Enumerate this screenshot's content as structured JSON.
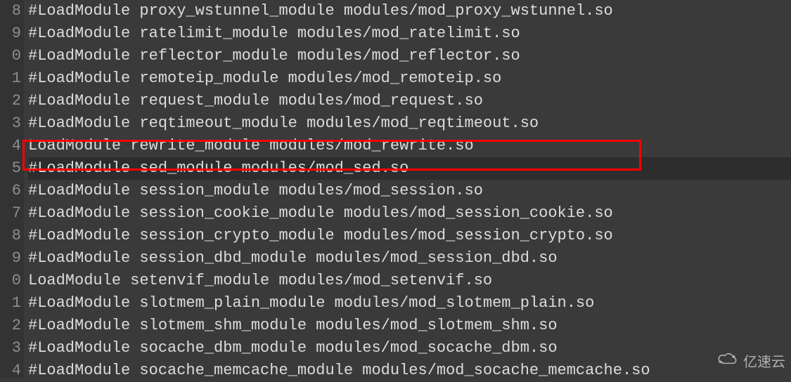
{
  "gutter": {
    "numbers": [
      "8",
      "9",
      "0",
      "1",
      "2",
      "3",
      "4",
      "5",
      "6",
      "7",
      "8",
      "9",
      "0",
      "1",
      "2",
      "3",
      "4"
    ]
  },
  "lines": [
    {
      "text": "#LoadModule proxy_wstunnel_module modules/mod_proxy_wstunnel.so",
      "current": false
    },
    {
      "text": "#LoadModule ratelimit_module modules/mod_ratelimit.so",
      "current": false
    },
    {
      "text": "#LoadModule reflector_module modules/mod_reflector.so",
      "current": false
    },
    {
      "text": "#LoadModule remoteip_module modules/mod_remoteip.so",
      "current": false
    },
    {
      "text": "#LoadModule request_module modules/mod_request.so",
      "current": false
    },
    {
      "text": "#LoadModule reqtimeout_module modules/mod_reqtimeout.so",
      "current": false
    },
    {
      "text": "LoadModule rewrite_module modules/mod_rewrite.so",
      "current": false
    },
    {
      "text": "#LoadModule sed_module modules/mod_sed.so",
      "current": true
    },
    {
      "text": "#LoadModule session_module modules/mod_session.so",
      "current": false
    },
    {
      "text": "#LoadModule session_cookie_module modules/mod_session_cookie.so",
      "current": false
    },
    {
      "text": "#LoadModule session_crypto_module modules/mod_session_crypto.so",
      "current": false
    },
    {
      "text": "#LoadModule session_dbd_module modules/mod_session_dbd.so",
      "current": false
    },
    {
      "text": "LoadModule setenvif_module modules/mod_setenvif.so",
      "current": false
    },
    {
      "text": "#LoadModule slotmem_plain_module modules/mod_slotmem_plain.so",
      "current": false
    },
    {
      "text": "#LoadModule slotmem_shm_module modules/mod_slotmem_shm.so",
      "current": false
    },
    {
      "text": "#LoadModule socache_dbm_module modules/mod_socache_dbm.so",
      "current": false
    },
    {
      "text": "#LoadModule socache_memcache_module modules/mod_socache_memcache.so",
      "current": false
    }
  ],
  "highlight": {
    "rowIndex": 6
  },
  "watermark": {
    "text": "亿速云"
  }
}
